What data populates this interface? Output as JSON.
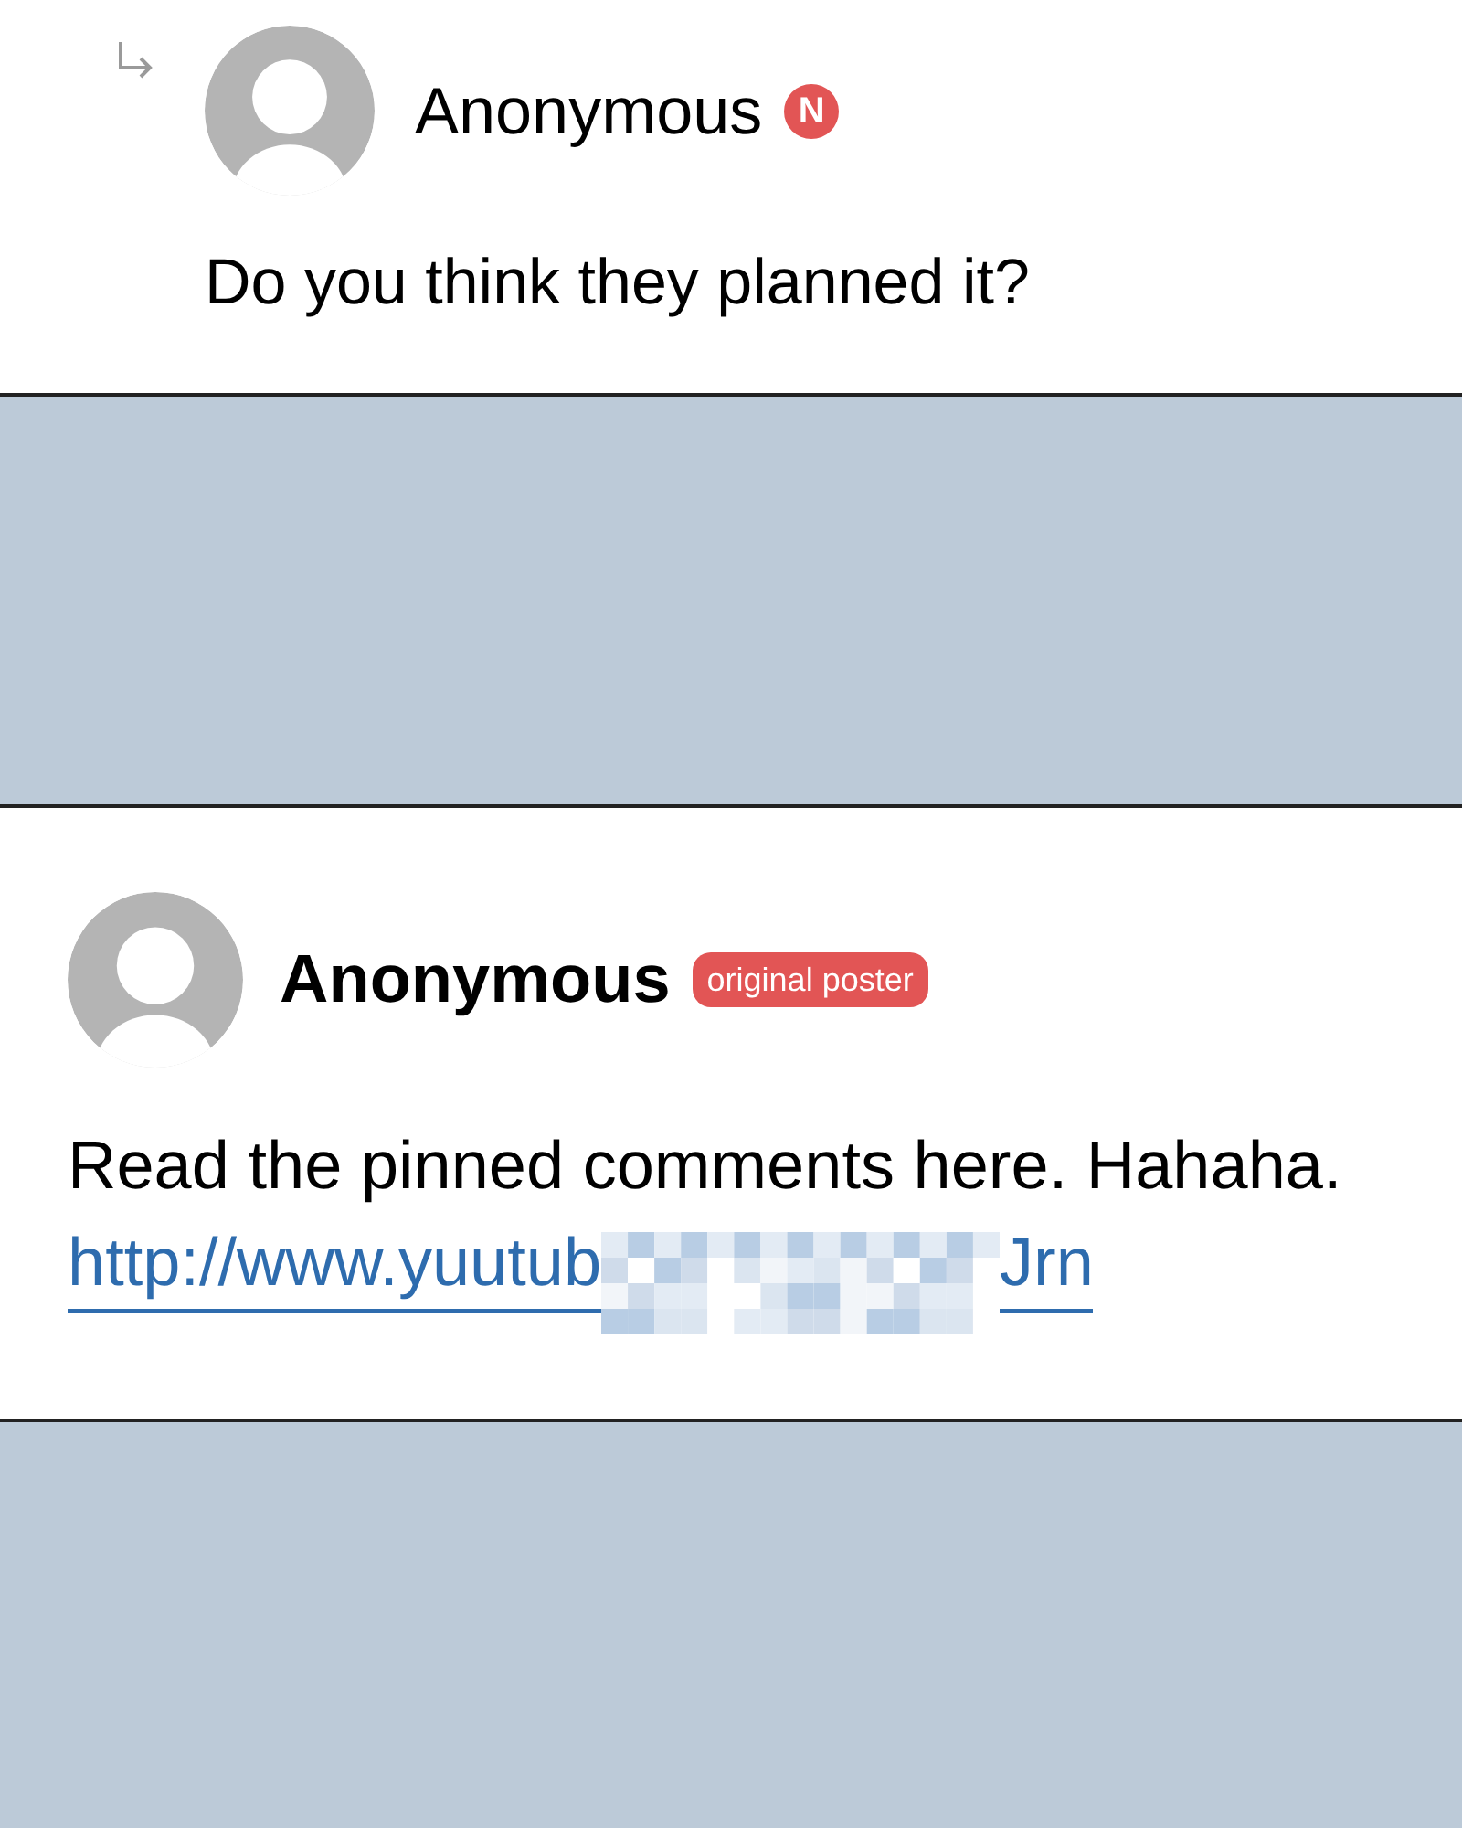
{
  "comments": [
    {
      "kind": "reply",
      "author": "Anonymous",
      "badge": {
        "kind": "circle",
        "text": "N",
        "color": "#e25555"
      },
      "text": "Do you think they planned it?"
    },
    {
      "kind": "post",
      "author": "Anonymous",
      "badge": {
        "kind": "pill",
        "text": "original poster",
        "color": "#e25555"
      },
      "text": "Read the pinned comments here. Hahaha.",
      "link": {
        "start": "http://www.yuutub",
        "end": "Jrn"
      }
    }
  ]
}
